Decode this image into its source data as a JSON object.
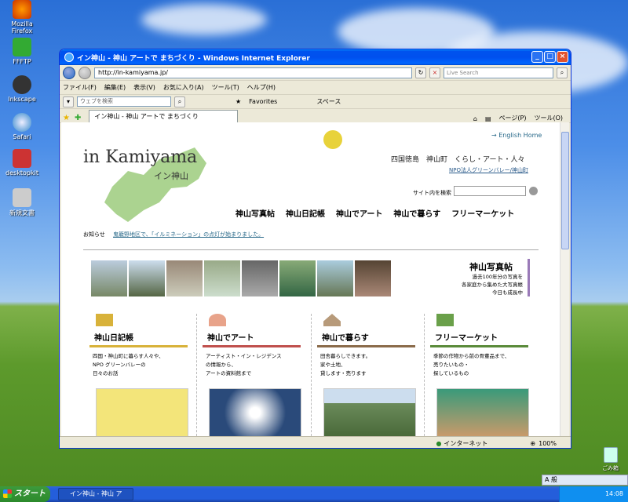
{
  "desktop": {
    "icons": [
      {
        "label": "Mozilla Firefox"
      },
      {
        "label": "FFFTP"
      },
      {
        "label": "Inkscape"
      },
      {
        "label": "Safari"
      },
      {
        "label": "desktopkit"
      },
      {
        "label": "新規文書"
      }
    ],
    "recycle_label": "ごみ箱"
  },
  "browser": {
    "title": "イン神山 - 神山 アートで まちづくり - Windows Internet Explorer",
    "address": "http://in-kamiyama.jp/",
    "live_search_placeholder": "Live Search",
    "menu": [
      "ファイル(F)",
      "編集(E)",
      "表示(V)",
      "お気に入り(A)",
      "ツール(T)",
      "ヘルプ(H)"
    ],
    "web_search_placeholder": "ウェブを検索",
    "favorites_label": "Favorites",
    "space_label": "スペース",
    "tab_title": "イン神山 - 神山 アートで まちづくり",
    "page_menu": "ページ(P)",
    "tools_menu": "ツール(O)",
    "status_zone": "インターネット",
    "zoom": "100%"
  },
  "site": {
    "logo": "in Kamiyama",
    "logo_sub": "イン神山",
    "english_link": "→ English Home",
    "tagline": "四国徳島　神山町　くらし・アート・人々",
    "npo": "NPO法人グリーンバレー/神山町",
    "search_label": "サイト内を検索",
    "nav": [
      "神山写真帖",
      "神山日記帳",
      "神山でアート",
      "神山で暮らす",
      "フリーマーケット"
    ],
    "news_label": "お知らせ",
    "news_text": "鬼籠野地区で、「イルミネーション」の点灯が始まりました。",
    "photobook": {
      "title": "神山写真帖",
      "desc": [
        "過去100年分の写真を",
        "各家庭から集めた大写真帳",
        "今日も成長中"
      ]
    },
    "columns": [
      {
        "title": "神山日記帳",
        "desc": [
          "四国・神山町に暮らす人々や、",
          "NPO グリーンバレーの",
          "日々のお話"
        ],
        "icon_color": "#d8b23a",
        "line_color": "#d8b23a"
      },
      {
        "title": "神山でアート",
        "desc": [
          "アーティスト・イン・レジデンス",
          "の情報から、",
          "アートの資料館まで"
        ],
        "icon_color": "#e8a38a",
        "line_color": "#c0504d"
      },
      {
        "title": "神山で暮らす",
        "desc": [
          "田舎暮らしできます。",
          "家や土地、",
          "貸します・売ります"
        ],
        "icon_color": "#b79a7a",
        "line_color": "#8a6b4a"
      },
      {
        "title": "フリーマーケット",
        "desc": [
          "季節の作物から前の骨董品まで、",
          "売りたいもの・",
          "探しているもの"
        ],
        "icon_color": "#6aa04a",
        "line_color": "#5a8a3a"
      }
    ]
  },
  "taskbar": {
    "start_label": "スタート",
    "task_label": "イン神山 - 神山 アー...",
    "clock": "14:08",
    "langbar": "A 般"
  }
}
